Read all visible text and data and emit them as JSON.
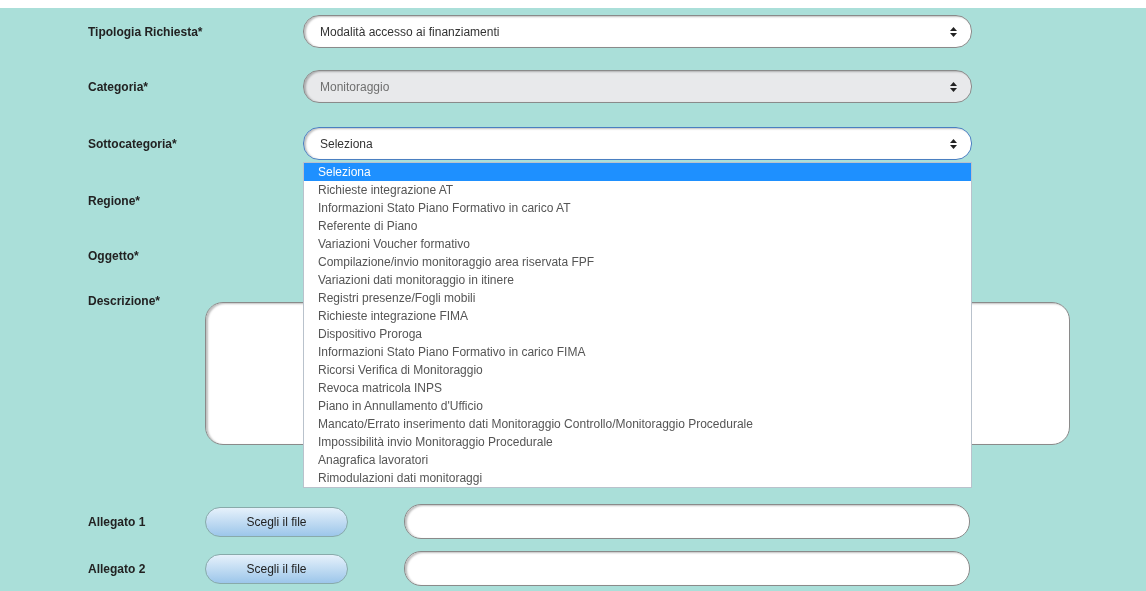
{
  "selects": [
    {
      "label": "Tipologia Richiesta*",
      "value": "Modalità accesso ai finanziamenti",
      "disabled": false,
      "open": false
    },
    {
      "label": "Categoria*",
      "value": "Monitoraggio",
      "disabled": true,
      "open": false
    },
    {
      "label": "Sottocategoria*",
      "value": "Seleziona",
      "disabled": false,
      "open": true,
      "options": [
        {
          "label": "Seleziona",
          "selected": true
        },
        {
          "label": "Richieste integrazione AT",
          "selected": false
        },
        {
          "label": "Informazioni Stato Piano Formativo in carico AT",
          "selected": false
        },
        {
          "label": "Referente di Piano",
          "selected": false
        },
        {
          "label": "Variazioni Voucher formativo",
          "selected": false
        },
        {
          "label": "Compilazione/invio monitoraggio area riservata FPF",
          "selected": false
        },
        {
          "label": "Variazioni dati monitoraggio in itinere",
          "selected": false
        },
        {
          "label": "Registri presenze/Fogli mobili",
          "selected": false
        },
        {
          "label": "Richieste integrazione FIMA",
          "selected": false
        },
        {
          "label": "Dispositivo Proroga",
          "selected": false
        },
        {
          "label": "Informazioni Stato Piano Formativo in carico FIMA",
          "selected": false
        },
        {
          "label": "Ricorsi Verifica di Monitoraggio",
          "selected": false
        },
        {
          "label": "Revoca matricola INPS",
          "selected": false
        },
        {
          "label": "Piano in Annullamento d'Ufficio",
          "selected": false
        },
        {
          "label": "Mancato/Errato inserimento dati Monitoraggio Controllo/Monitoraggio Procedurale",
          "selected": false
        },
        {
          "label": "Impossibilità invio Monitoraggio Procedurale",
          "selected": false
        },
        {
          "label": "Anagrafica lavoratori",
          "selected": false
        },
        {
          "label": "Rimodulazioni dati monitoraggi",
          "selected": false
        }
      ]
    }
  ],
  "hidden_fields": [
    {
      "label": "Regione*"
    },
    {
      "label": "Oggetto*"
    }
  ],
  "description": {
    "label": "Descrizione*"
  },
  "attachments": [
    {
      "label": "Allegato 1",
      "button": "Scegli il file"
    },
    {
      "label": "Allegato 2",
      "button": "Scegli il file"
    }
  ]
}
